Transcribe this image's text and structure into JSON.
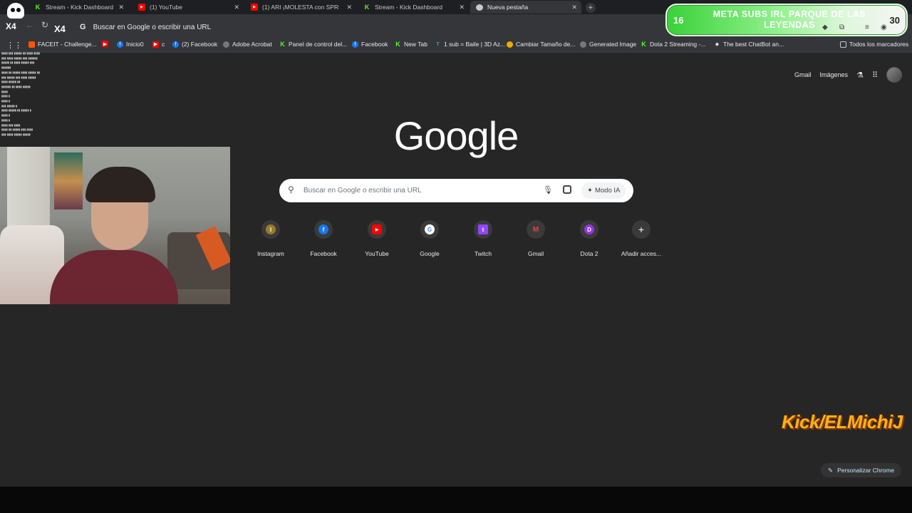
{
  "tabs": [
    {
      "title": "Stream - Kick Dashboard",
      "favicon": "kick-icon",
      "active": false
    },
    {
      "title": "(1) YouTube",
      "favicon": "youtube-icon",
      "active": false
    },
    {
      "title": "(1) ARI ¡MOLESTA con SPREEN",
      "favicon": "youtube-icon",
      "active": false
    },
    {
      "title": "Stream - Kick Dashboard",
      "favicon": "kick-icon",
      "active": false
    },
    {
      "title": "Nueva pestaña",
      "favicon": "chrome-icon",
      "active": true
    }
  ],
  "omnibox": {
    "text": "Buscar en Google o escribir una URL"
  },
  "bookmarks": [
    {
      "label": "FACEIT - Challenge...",
      "color": "#ff5500"
    },
    {
      "label": "",
      "color": "#ff0000"
    },
    {
      "label": "Inicio0",
      "color": "#1877f2"
    },
    {
      "label": "c",
      "color": "#ff0000"
    },
    {
      "label": "(2) Facebook",
      "color": "#1877f2"
    },
    {
      "label": "Adobe Acrobat",
      "color": "#777777"
    },
    {
      "label": "Panel de control del...",
      "color": "#53fc18"
    },
    {
      "label": "Facebook",
      "color": "#1877f2"
    },
    {
      "label": "New Tab",
      "color": "#53fc18"
    },
    {
      "label": "1 sub = Baile | 3D Az...",
      "color": "#2aa8e0"
    },
    {
      "label": "Cambiar Tamaño de...",
      "color": "#f2a900"
    },
    {
      "label": "Generated Image",
      "color": "#777777"
    },
    {
      "label": "Dota 2 Streaming -...",
      "color": "#53fc18"
    },
    {
      "label": "The best ChatBot an...",
      "color": "#dddddd"
    }
  ],
  "bookmarks_all": "Todos los marcadores",
  "toplinks": {
    "gmail": "Gmail",
    "images": "Imágenes"
  },
  "logo": "Google",
  "search": {
    "placeholder": "Buscar en Google o escribir una URL",
    "ai_mode": "Modo IA"
  },
  "shortcuts": [
    {
      "label": "Instagram",
      "letter": "I",
      "color": "#9c7a2a"
    },
    {
      "label": "Facebook",
      "letter": "f",
      "color": "#1877f2"
    },
    {
      "label": "YouTube",
      "letter": "▶",
      "color": "#ff0000"
    },
    {
      "label": "Google",
      "letter": "G",
      "color": "#4285f4"
    },
    {
      "label": "Twitch",
      "letter": "t",
      "color": "#9146ff"
    },
    {
      "label": "Gmail",
      "letter": "M",
      "color": "#ea4335"
    },
    {
      "label": "Dota 2",
      "letter": "D",
      "color": "#9334e6"
    },
    {
      "label": "Añadir acces...",
      "letter": "+",
      "color": "#3a3a3a"
    }
  ],
  "customize": "Personalizar Chrome",
  "overlay": {
    "current": "16",
    "goal": "META SUBS IRL PARQUE DE LAS LEYENDAS",
    "target": "30",
    "progress": 0.53
  },
  "brand_watermark": "Kick/ELMichiJ",
  "stream_badge": {
    "left": "X4",
    "right": "X4"
  },
  "colors": {
    "accent": "#53fc18",
    "page_bg": "#262626",
    "chrome_bg": "#35363a"
  }
}
